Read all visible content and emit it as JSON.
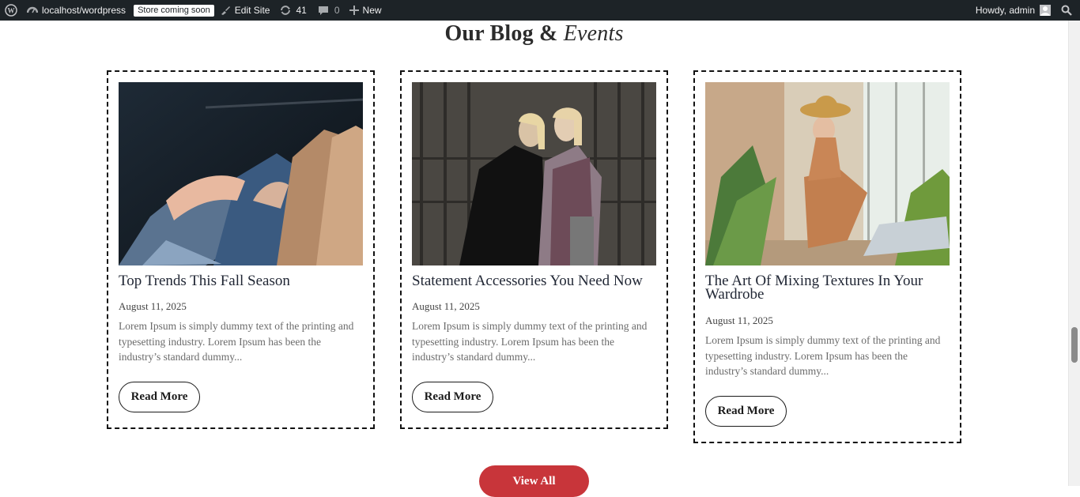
{
  "admin_bar": {
    "site_name": "localhost/wordpress",
    "store_badge": "Store coming soon",
    "edit_site": "Edit Site",
    "updates_count": "41",
    "comments_count": "0",
    "new_label": "New",
    "howdy": "Howdy, admin"
  },
  "section": {
    "title_plain": "Our Blog &",
    "title_italic": "Events"
  },
  "posts": [
    {
      "title": "Top Trends This Fall Season",
      "date": "August 11, 2025",
      "excerpt": "Lorem Ipsum is simply dummy text of the printing and typesetting industry. Lorem Ipsum has been the industry’s standard dummy...",
      "button": "Read More"
    },
    {
      "title": "Statement Accessories You Need Now",
      "date": "August 11, 2025",
      "excerpt": "Lorem Ipsum is simply dummy text of the printing and typesetting industry. Lorem Ipsum has been the industry’s standard dummy...",
      "button": "Read More"
    },
    {
      "title": "The Art Of Mixing Textures In Your Wardrobe",
      "date": "August 11, 2025",
      "excerpt": "Lorem Ipsum is simply dummy text of the printing and typesetting industry. Lorem Ipsum has been the industry’s standard dummy...",
      "button": "Read More"
    }
  ],
  "view_all": "View All",
  "colors": {
    "admin_bar_bg": "#1d2327",
    "accent_red": "#c8353a",
    "title_text": "#1f2533"
  }
}
